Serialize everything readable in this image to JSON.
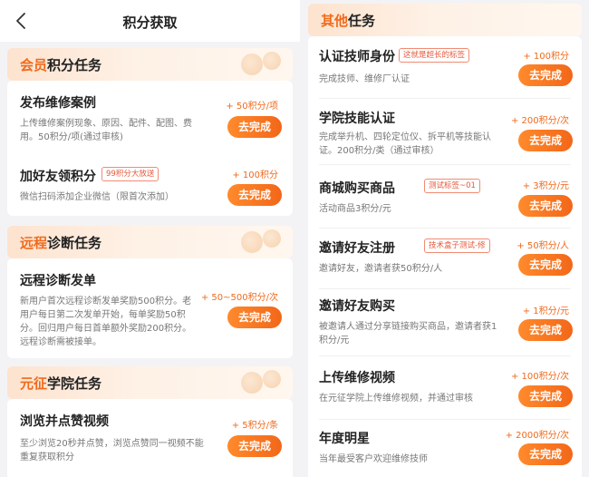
{
  "header": {
    "title": "积分获取",
    "back_icon": "chevron-left-icon"
  },
  "colors": {
    "accent": "#f06a1c",
    "button": "#f26719",
    "tag_border": "#f08b73",
    "section_bg": "#fde3cf"
  },
  "sections": {
    "member": {
      "title_accent": "会员",
      "title_rest": "积分任务",
      "tasks": [
        {
          "title": "发布维修案例",
          "reward": "+ 50积分/项",
          "desc": "上传维修案例现象、原因、配件、配图、费用。50积分/项(通过审核)",
          "button": "去完成"
        },
        {
          "title": "加好友领积分",
          "tag": "99积分大放送",
          "reward": "+ 100积分",
          "desc": "微信扫码添加企业微信（限首次添加）",
          "button": "去完成"
        }
      ]
    },
    "remote": {
      "title_accent": "远程",
      "title_rest": "诊断任务",
      "tasks": [
        {
          "title": "远程诊断发单",
          "reward": "+ 50~500积分/次",
          "desc": "新用户首次远程诊断发单奖励500积分。老用户每日第二次发单开始，每单奖励50积分。回归用户每日首单额外奖励200积分。远程诊断需被接单。",
          "button": "去完成"
        }
      ]
    },
    "academy": {
      "title_accent": "元征",
      "title_rest": "学院任务",
      "tasks": [
        {
          "title": "浏览并点赞视频",
          "reward": "+ 5积分/条",
          "desc": "至少浏览20秒并点赞，浏览点赞同一视频不能重复获取积分",
          "button": "去完成"
        }
      ]
    },
    "other": {
      "title_accent": "其他",
      "title_rest": "任务",
      "tasks": [
        {
          "title": "认证技师身份",
          "tag": "这就是超长的标签",
          "reward": "+ 100积分",
          "desc": "完成技师、维修厂认证",
          "button": "去完成"
        },
        {
          "title": "学院技能认证",
          "reward": "+ 200积分/次",
          "desc": "完成举升机、四轮定位仪、拆平机等技能认证。200积分/类（通过审核）",
          "button": "去完成"
        },
        {
          "title": "商城购买商品",
          "tag": "测试标签~01",
          "reward": "+ 3积分/元",
          "desc": "活动商品3积分/元",
          "button": "去完成"
        },
        {
          "title": "邀请好友注册",
          "tag": "技术盒子测试-修",
          "reward": "+ 50积分/人",
          "desc": "邀请好友，邀请者获50积分/人",
          "button": "去完成"
        },
        {
          "title": "邀请好友购买",
          "reward": "+ 1积分/元",
          "desc": "被邀请人通过分享链接购买商品，邀请者获1积分/元",
          "button": "去完成"
        },
        {
          "title": "上传维修视频",
          "reward": "+ 100积分/次",
          "desc": "在元征学院上传维修视频，并通过审核",
          "button": "去完成"
        },
        {
          "title": "年度明星",
          "reward": "+ 2000积分/次",
          "desc": "当年最受客户欢迎维修技师",
          "button": "去完成"
        }
      ]
    }
  }
}
